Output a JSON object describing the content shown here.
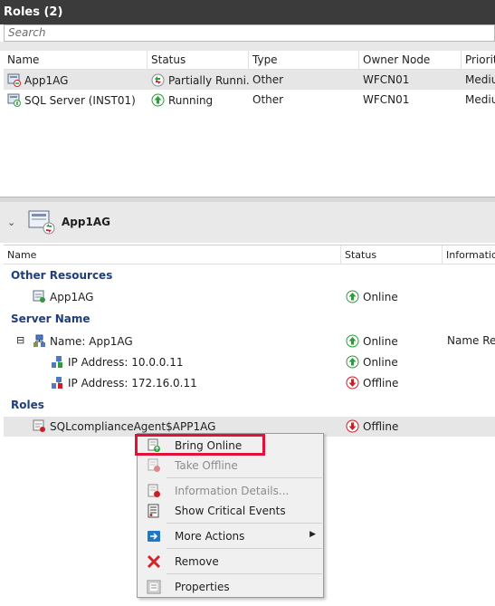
{
  "roles_panel": {
    "title": "Roles (2)",
    "search_placeholder": "Search",
    "columns": [
      "Name",
      "Status",
      "Type",
      "Owner Node",
      "Priority"
    ],
    "rows": [
      {
        "name": "App1AG",
        "status": "Partially Runni...",
        "type": "Other",
        "owner": "WFCN01",
        "priority": "Medium",
        "status_icon": "partial-running-icon",
        "selected": true
      },
      {
        "name": "SQL Server (INST01)",
        "status": "Running",
        "type": "Other",
        "owner": "WFCN01",
        "priority": "Medium",
        "status_icon": "running-icon",
        "selected": false
      }
    ]
  },
  "detail_panel": {
    "title": "App1AG",
    "columns": [
      "Name",
      "Status",
      "Information"
    ],
    "groups": {
      "other_resources": "Other Resources",
      "server_name": "Server Name",
      "roles": "Roles"
    },
    "items": {
      "app1ag": {
        "name": "App1AG",
        "status": "Online"
      },
      "name_app1ag": {
        "name": "Name: App1AG",
        "status": "Online",
        "info": "Name Res",
        "expander": "⊟"
      },
      "ip1": {
        "name": "IP Address: 10.0.0.11",
        "status": "Online"
      },
      "ip2": {
        "name": "IP Address: 172.16.0.11",
        "status": "Offline"
      },
      "agent": {
        "name": "SQLcomplianceAgent$APP1AG",
        "status": "Offline"
      }
    }
  },
  "context_menu": {
    "items": [
      {
        "label": "Bring Online",
        "enabled": true,
        "icon": "bring-online-icon"
      },
      {
        "label": "Take Offline",
        "enabled": false,
        "icon": "take-offline-icon"
      },
      {
        "label": "Information Details...",
        "enabled": false,
        "icon": "information-details-icon"
      },
      {
        "label": "Show Critical Events",
        "enabled": true,
        "icon": "critical-events-icon"
      },
      {
        "label": "More Actions",
        "enabled": true,
        "icon": "more-actions-icon",
        "submenu": true
      },
      {
        "label": "Remove",
        "enabled": true,
        "icon": "remove-icon"
      },
      {
        "label": "Properties",
        "enabled": true,
        "icon": "properties-icon"
      }
    ],
    "highlighted": "Bring Online"
  },
  "colors": {
    "titlebar": "#3b3b3b",
    "group_header": "#1f3e7a",
    "online_green": "#2e9b3a",
    "offline_red": "#c8202a",
    "highlight_box": "#e0123a"
  }
}
